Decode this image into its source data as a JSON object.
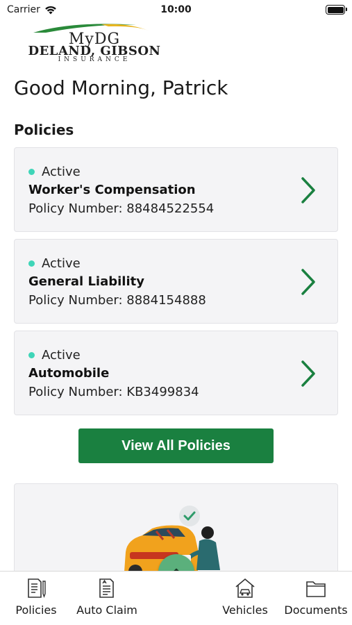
{
  "status_bar": {
    "carrier": "Carrier",
    "time": "10:00"
  },
  "logo": {
    "brand": "MyDG",
    "line2": "DELAND, GIBSON",
    "line3": "INSURANCE"
  },
  "greeting": "Good Morning, Patrick",
  "policies_section": {
    "title": "Policies",
    "items": [
      {
        "status": "Active",
        "name": "Worker's Compensation",
        "number": "Policy Number: 88484522554"
      },
      {
        "status": "Active",
        "name": "General Liability",
        "number": "Policy Number: 8884154888"
      },
      {
        "status": "Active",
        "name": "Automobile",
        "number": "Policy Number: KB3499834"
      }
    ],
    "view_all_label": "View All Policies"
  },
  "tabs": [
    {
      "label": "Policies",
      "icon": "policy-document-icon"
    },
    {
      "label": "Auto Claim",
      "icon": "auto-claim-icon"
    },
    {
      "label": "Vehicles",
      "icon": "vehicles-icon"
    },
    {
      "label": "Documents",
      "icon": "folder-icon"
    }
  ],
  "fab_icon": "chevron-up-icon",
  "colors": {
    "primary_green": "#1a8040",
    "fab_green": "#5bb07c",
    "active_dot": "#3fd5b8",
    "card_bg": "#f4f4f6"
  }
}
